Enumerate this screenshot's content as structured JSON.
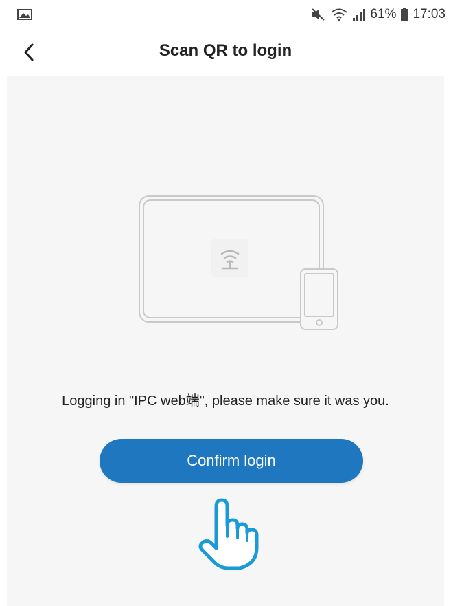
{
  "status_bar": {
    "battery": "61%",
    "time": "17:03",
    "icons": [
      "image-notification-icon",
      "mute-icon",
      "wifi-icon",
      "signal-icon",
      "battery-icon"
    ]
  },
  "header": {
    "title": "Scan QR to login",
    "back_icon": "chevron-left-icon"
  },
  "illustration": {
    "devices": [
      "tablet",
      "phone"
    ],
    "center_icon": "camera-logo-icon"
  },
  "main": {
    "message": "Logging in \"IPC web端\", please make sure it was you.",
    "confirm_label": "Confirm login"
  },
  "colors": {
    "accent": "#1f78bf",
    "background": "#f6f6f6",
    "hand_outline": "#1a9bd7"
  }
}
